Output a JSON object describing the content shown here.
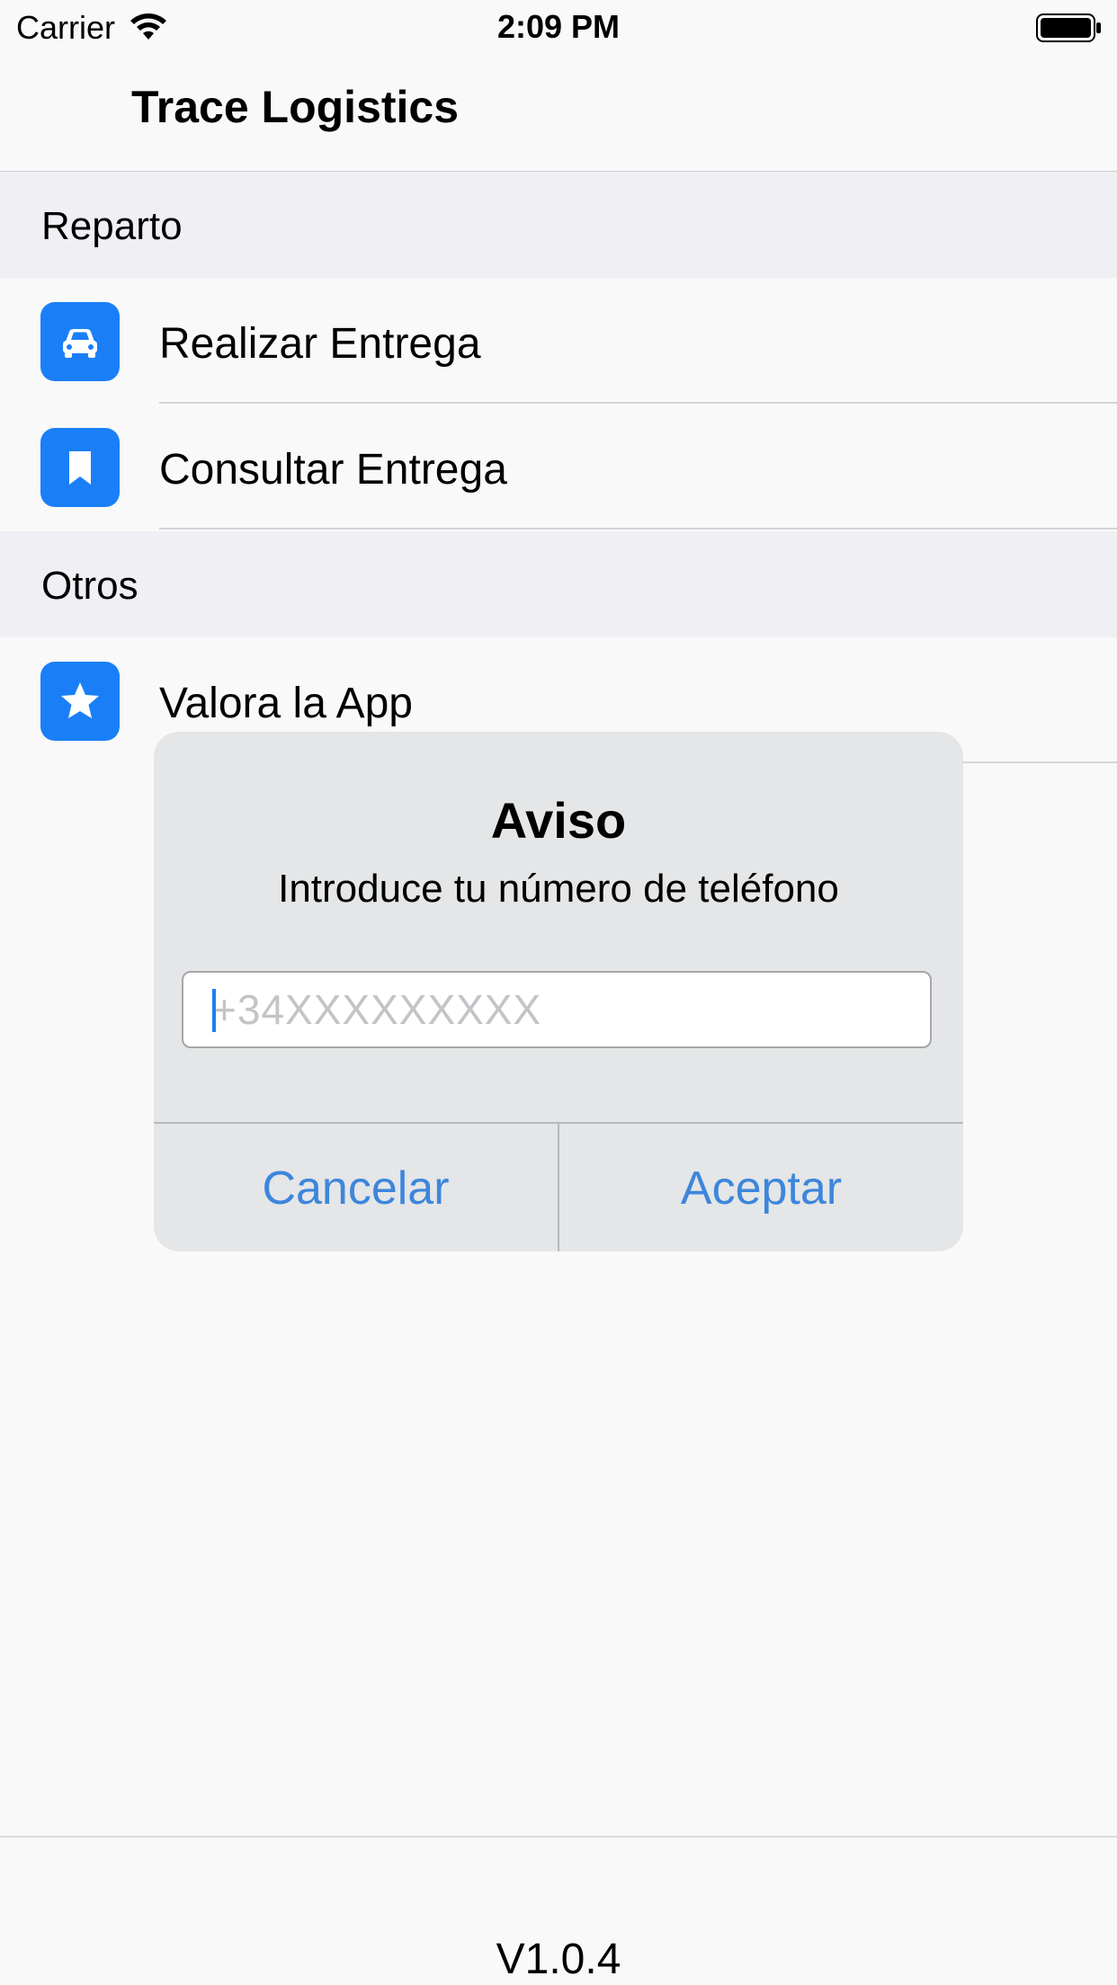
{
  "status_bar": {
    "carrier": "Carrier",
    "time": "2:09 PM"
  },
  "nav": {
    "title": "Trace Logistics"
  },
  "sections": {
    "reparto": {
      "header": "Reparto",
      "items": [
        {
          "label": "Realizar Entrega",
          "icon": "car-icon"
        },
        {
          "label": "Consultar Entrega",
          "icon": "bookmark-icon"
        }
      ]
    },
    "otros": {
      "header": "Otros",
      "items": [
        {
          "label": "Valora la App",
          "icon": "star-icon"
        }
      ]
    }
  },
  "dialog": {
    "title": "Aviso",
    "message": "Introduce tu número de teléfono",
    "input_placeholder": "+34XXXXXXXXX",
    "cancel_label": "Cancelar",
    "accept_label": "Aceptar"
  },
  "footer": {
    "version": "V1.0.4"
  },
  "colors": {
    "accent": "#1a7ff7",
    "button_text": "#3d86dc",
    "section_bg": "#efeff4"
  }
}
